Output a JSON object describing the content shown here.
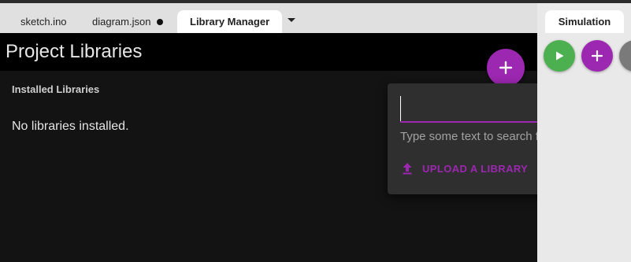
{
  "tabs": [
    {
      "label": "sketch.ino"
    },
    {
      "label": "diagram.json",
      "modified": true
    },
    {
      "label": "Library Manager",
      "active": true
    }
  ],
  "library_manager": {
    "title": "Project Libraries",
    "installed_heading": "Installed Libraries",
    "empty_message": "No libraries installed."
  },
  "search_popup": {
    "input_value": "",
    "placeholder": "",
    "hint": "Type some text to search for libraries",
    "upload_label": "UPLOAD A LIBRARY"
  },
  "simulation": {
    "tab_label": "Simulation"
  },
  "icons": {
    "add_library": "plus-icon",
    "search": "search-icon",
    "upload": "upload-icon",
    "play": "play-icon",
    "add_part": "plus-icon"
  },
  "colors": {
    "accent": "#9c27b0",
    "play": "#4caf50",
    "header_bg": "#000000",
    "panel_bg": "#131313",
    "popup_bg": "#2f2f2f"
  }
}
